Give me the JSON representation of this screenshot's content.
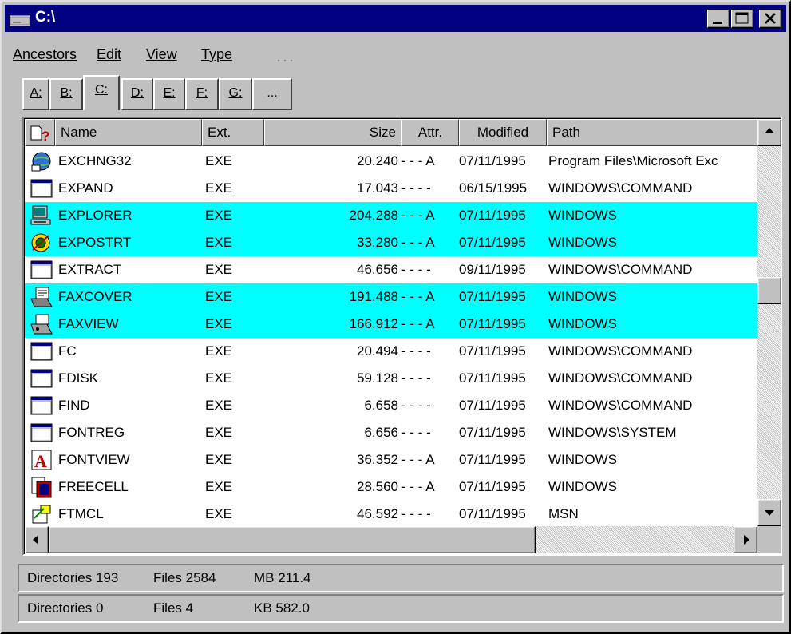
{
  "window": {
    "title": "C:\\"
  },
  "menu": {
    "items": [
      {
        "label": "Ancestors"
      },
      {
        "label": "Edit"
      },
      {
        "label": "View"
      },
      {
        "label": "Type"
      }
    ]
  },
  "tabs": [
    {
      "label": "A:"
    },
    {
      "label": "B:"
    },
    {
      "label": "C:",
      "active": true
    },
    {
      "label": "D:"
    },
    {
      "label": "E:"
    },
    {
      "label": "F:"
    },
    {
      "label": "G:"
    },
    {
      "label": "..."
    }
  ],
  "columns": {
    "name": "Name",
    "ext": "Ext.",
    "size": "Size",
    "attr": "Attr.",
    "modified": "Modified",
    "path": "Path"
  },
  "files": [
    {
      "name": "EXCHNG32",
      "ext": "EXE",
      "size": "20.240",
      "attr": "- - - A",
      "modified": "07/11/1995",
      "path": "Program Files\\Microsoft Exc",
      "icon": "exchange-icon",
      "highlight": false
    },
    {
      "name": "EXPAND",
      "ext": "EXE",
      "size": "17.043",
      "attr": "- - - -",
      "modified": "06/15/1995",
      "path": "WINDOWS\\COMMAND",
      "icon": "dos-program-icon",
      "highlight": false
    },
    {
      "name": "EXPLORER",
      "ext": "EXE",
      "size": "204.288",
      "attr": "- - - A",
      "modified": "07/11/1995",
      "path": "WINDOWS",
      "icon": "explorer-computer-icon",
      "highlight": true
    },
    {
      "name": "EXPOSTRT",
      "ext": "EXE",
      "size": "33.280",
      "attr": "- - - A",
      "modified": "07/11/1995",
      "path": "WINDOWS",
      "icon": "expostrt-icon",
      "highlight": true
    },
    {
      "name": "EXTRACT",
      "ext": "EXE",
      "size": "46.656",
      "attr": "- - - -",
      "modified": "09/11/1995",
      "path": "WINDOWS\\COMMAND",
      "icon": "dos-program-icon",
      "highlight": false
    },
    {
      "name": "FAXCOVER",
      "ext": "EXE",
      "size": "191.488",
      "attr": "- - - A",
      "modified": "07/11/1995",
      "path": "WINDOWS",
      "icon": "fax-cover-icon",
      "highlight": true
    },
    {
      "name": "FAXVIEW",
      "ext": "EXE",
      "size": "166.912",
      "attr": "- - - A",
      "modified": "07/11/1995",
      "path": "WINDOWS",
      "icon": "fax-view-icon",
      "highlight": true
    },
    {
      "name": "FC",
      "ext": "EXE",
      "size": "20.494",
      "attr": "- - - -",
      "modified": "07/11/1995",
      "path": "WINDOWS\\COMMAND",
      "icon": "dos-program-icon",
      "highlight": false
    },
    {
      "name": "FDISK",
      "ext": "EXE",
      "size": "59.128",
      "attr": "- - - -",
      "modified": "07/11/1995",
      "path": "WINDOWS\\COMMAND",
      "icon": "dos-program-icon",
      "highlight": false
    },
    {
      "name": "FIND",
      "ext": "EXE",
      "size": "6.658",
      "attr": "- - - -",
      "modified": "07/11/1995",
      "path": "WINDOWS\\COMMAND",
      "icon": "dos-program-icon",
      "highlight": false
    },
    {
      "name": "FONTREG",
      "ext": "EXE",
      "size": "6.656",
      "attr": "- - - -",
      "modified": "07/11/1995",
      "path": "WINDOWS\\SYSTEM",
      "icon": "dos-program-icon",
      "highlight": false
    },
    {
      "name": "FONTVIEW",
      "ext": "EXE",
      "size": "36.352",
      "attr": "- - - A",
      "modified": "07/11/1995",
      "path": "WINDOWS",
      "icon": "font-a-icon",
      "highlight": false
    },
    {
      "name": "FREECELL",
      "ext": "EXE",
      "size": "28.560",
      "attr": "- - - A",
      "modified": "07/11/1995",
      "path": "WINDOWS",
      "icon": "freecell-cards-icon",
      "highlight": false
    },
    {
      "name": "FTMCL",
      "ext": "EXE",
      "size": "46.592",
      "attr": "- - - -",
      "modified": "07/11/1995",
      "path": "MSN",
      "icon": "ftmcl-icon",
      "highlight": false
    }
  ],
  "status": {
    "line1": {
      "dirs": "Directories 193",
      "files": "Files 2584",
      "size": "MB 211.4"
    },
    "line2": {
      "dirs": "Directories 0",
      "files": "Files 4",
      "size": "KB 582.0"
    }
  },
  "colors": {
    "titlebar": "#000080",
    "highlight": "#00ffff",
    "face": "#c0c0c0"
  }
}
